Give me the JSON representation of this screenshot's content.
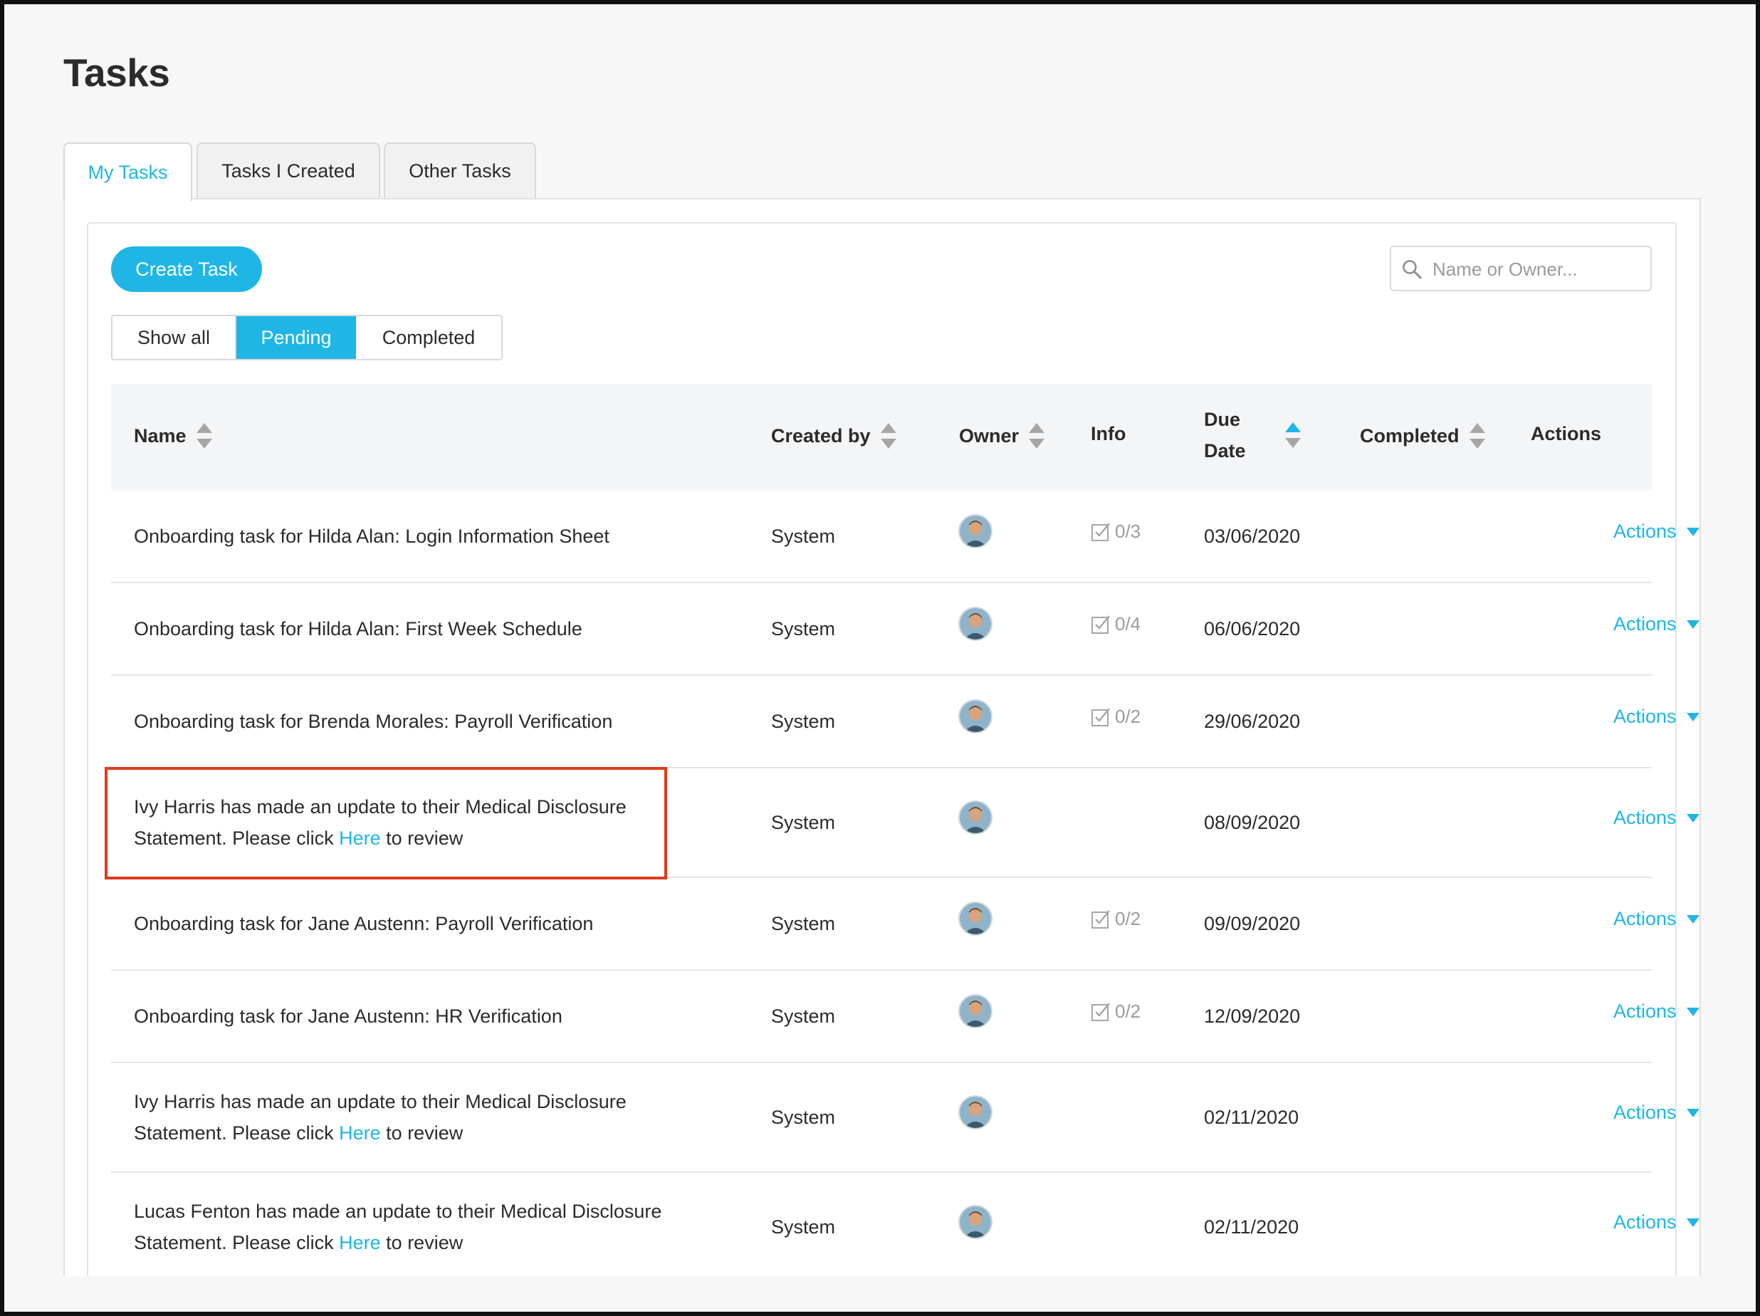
{
  "page": {
    "title": "Tasks"
  },
  "tabs": [
    {
      "label": "My Tasks",
      "active": true
    },
    {
      "label": "Tasks I Created",
      "active": false
    },
    {
      "label": "Other Tasks",
      "active": false
    }
  ],
  "toolbar": {
    "create_label": "Create Task",
    "search_placeholder": "Name or Owner...",
    "search_value": ""
  },
  "filters": [
    {
      "label": "Show all",
      "active": false
    },
    {
      "label": "Pending",
      "active": true
    },
    {
      "label": "Completed",
      "active": false
    }
  ],
  "columns": {
    "name": "Name",
    "created_by": "Created by",
    "owner": "Owner",
    "info": "Info",
    "due_date": "Due Date",
    "completed": "Completed",
    "actions": "Actions"
  },
  "rows": [
    {
      "name": "Onboarding task for Hilda Alan: Login Information Sheet",
      "created_by": "System",
      "info": "0/3",
      "due": "03/06/2020",
      "actions": "Actions"
    },
    {
      "name": "Onboarding task for Hilda Alan: First Week Schedule",
      "created_by": "System",
      "info": "0/4",
      "due": "06/06/2020",
      "actions": "Actions"
    },
    {
      "name": "Onboarding task for Brenda Morales: Payroll Verification",
      "created_by": "System",
      "info": "0/2",
      "due": "29/06/2020",
      "actions": "Actions"
    },
    {
      "name_line1": "Ivy Harris has made an update to their Medical Disclosure",
      "name_pre": "Statement. Please click ",
      "name_link": "Here",
      "name_post": " to review",
      "created_by": "System",
      "due": "08/09/2020",
      "actions": "Actions"
    },
    {
      "name": "Onboarding task for Jane Austenn: Payroll Verification",
      "created_by": "System",
      "info": "0/2",
      "due": "09/09/2020",
      "actions": "Actions"
    },
    {
      "name": "Onboarding task for Jane Austenn: HR Verification",
      "created_by": "System",
      "info": "0/2",
      "due": "12/09/2020",
      "actions": "Actions"
    },
    {
      "name_line1": "Ivy Harris has made an update to their Medical Disclosure",
      "name_pre": "Statement. Please click ",
      "name_link": "Here",
      "name_post": " to review",
      "created_by": "System",
      "due": "02/11/2020",
      "actions": "Actions"
    },
    {
      "name_line1": "Lucas Fenton has made an update to their Medical Disclosure",
      "name_pre": "Statement. Please click ",
      "name_link": "Here",
      "name_post": " to review",
      "created_by": "System",
      "due": "02/11/2020",
      "actions": "Actions"
    }
  ],
  "colors": {
    "accent": "#1fb6e6",
    "highlight": "#e03a1f",
    "header_bg": "#f4f5f7"
  },
  "icons": {
    "search": "search-icon",
    "checklist": "checkbox-icon",
    "sort": "sort-icon",
    "caret": "caret-down-icon",
    "avatar": "owner-avatar"
  }
}
